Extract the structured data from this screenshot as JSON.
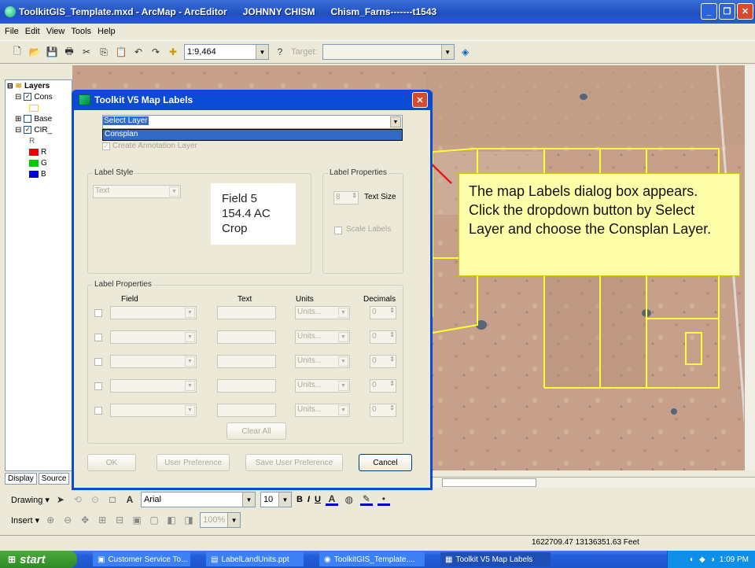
{
  "window": {
    "title": "ToolkitGIS_Template.mxd - ArcMap - ArcEditor      JOHNNY CHISM      Chism_Farns-------t1543"
  },
  "menu": [
    "File",
    "Edit",
    "View",
    "Tools",
    "Help"
  ],
  "toolbar": {
    "scale": "1:9,464",
    "target_label": "Target:"
  },
  "toc": {
    "root": "Layers",
    "layers": [
      "Cons",
      "Base",
      "CIR_"
    ],
    "band_labels": [
      "R",
      "G",
      "B"
    ],
    "tabs": [
      "Display",
      "Source"
    ]
  },
  "dialog": {
    "title": "Toolkit V5 Map Labels",
    "select_layer": "Select Layer",
    "dropdown_option": "Consplan",
    "create_annotation": "Create Annotation Layer",
    "label_style_group": "Label Style",
    "label_style_value": "Text",
    "preview": [
      "Field 5",
      "154.4 AC",
      "Crop"
    ],
    "label_props_right": "Label Properties",
    "text_size_value": "8",
    "text_size_label": "Text Size",
    "scale_labels": "Scale Labels",
    "label_props_group": "Label Properties",
    "col_field": "Field",
    "col_text": "Text",
    "col_units": "Units",
    "col_decimals": "Decimals",
    "units_placeholder": "Units...",
    "decimals_value": "0",
    "clear_all": "Clear All",
    "ok": "OK",
    "user_pref": "User Preference",
    "save_pref": "Save User Preference",
    "cancel": "Cancel"
  },
  "callout": "The map Labels dialog box appears. Click the dropdown button by Select Layer and choose the Consplan Layer.",
  "drawing_toolbar": {
    "drawing": "Drawing",
    "font": "Arial",
    "size": "10",
    "bold": "B",
    "italic": "I",
    "underline": "U"
  },
  "insert_toolbar": {
    "insert": "Insert",
    "zoom": "100%"
  },
  "status": {
    "coords": "1622709.47  13136351.63 Feet"
  },
  "taskbar": {
    "start": "start",
    "tasks": [
      "Customer Service To...",
      "LabelLandUnits.ppt",
      "ToolkitGIS_Template....",
      "Toolkit V5 Map Labels"
    ],
    "clock": "1:09 PM"
  },
  "colors": {
    "accent": "#0a4ad4",
    "callout_bg": "#ffffaa",
    "arrow": "#e31a1a",
    "parcel": "#ffff33"
  }
}
